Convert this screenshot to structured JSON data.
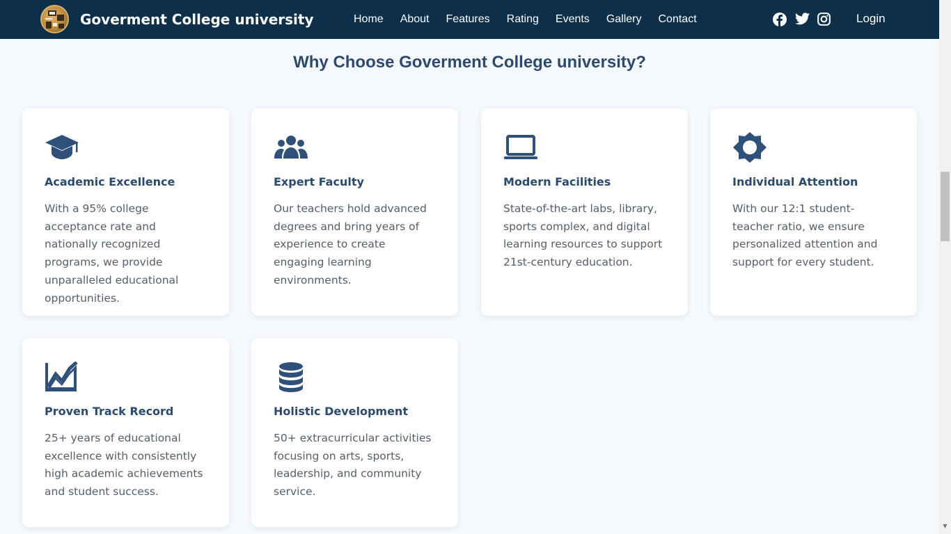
{
  "nav": {
    "brand": "Goverment College university",
    "links": [
      "Home",
      "About",
      "Features",
      "Rating",
      "Events",
      "Gallery",
      "Contact"
    ],
    "socials": [
      "facebook-icon",
      "twitter-icon",
      "instagram-icon"
    ],
    "login": "Login"
  },
  "features": {
    "title": "Why Choose Goverment College university?",
    "cards": [
      {
        "icon": "graduation-cap-icon",
        "title": "Academic Excellence",
        "text": "With a 95% college acceptance rate and nationally recognized programs, we provide unparalleled educational opportunities."
      },
      {
        "icon": "users-icon",
        "title": "Expert Faculty",
        "text": "Our teachers hold advanced degrees and bring years of experience to create engaging learning environments."
      },
      {
        "icon": "laptop-icon",
        "title": "Modern Facilities",
        "text": "State-of-the-art labs, library, sports complex, and digital learning resources to support 21st-century education."
      },
      {
        "icon": "badge-icon",
        "title": "Individual Attention",
        "text": "With our 12:1 student-teacher ratio, we ensure personalized attention and support for every student."
      },
      {
        "icon": "chart-line-icon",
        "title": "Proven Track Record",
        "text": "25+ years of educational excellence with consistently high academic achievements and student success."
      },
      {
        "icon": "database-icon",
        "title": "Holistic Development",
        "text": "50+ extracurricular activities focusing on arts, sports, leadership, and community service."
      }
    ]
  },
  "colors": {
    "navbar": "#0d2f4a",
    "accent": "#2b4a6e",
    "icon": "#2e5079",
    "background": "#f5f8fc",
    "card": "#ffffff"
  }
}
